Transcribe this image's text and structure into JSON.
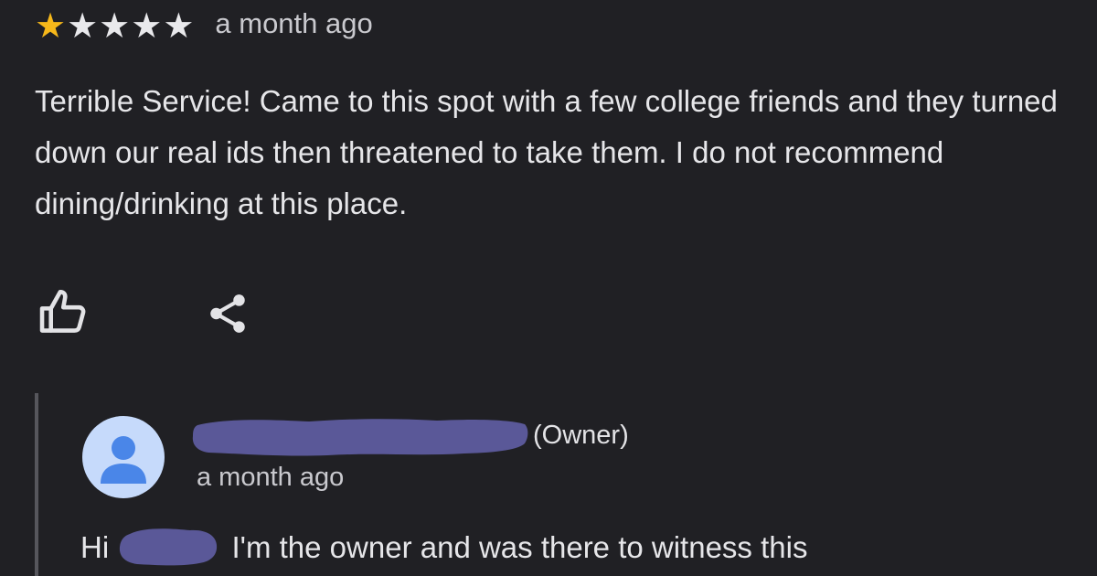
{
  "review": {
    "rating": 1,
    "max_rating": 5,
    "star_colors": {
      "filled": "#f6b81a",
      "empty": "#e9e9ec"
    },
    "date": "a month ago",
    "text": "Terrible Service! Came to this spot with a few college friends and they turned down our real ids then threatened to take them. I do not recommend dining/drinking at this place.",
    "actions": {
      "like_icon": "thumbs-up-outline-icon",
      "share_icon": "share-icon"
    }
  },
  "owner_reply": {
    "avatar_icon": "default-person-avatar",
    "avatar_colors": {
      "background": "#c6dafb",
      "figure": "#4a86e8"
    },
    "redaction_color": "#5a5898",
    "owner_tag": "(Owner)",
    "date": "a month ago",
    "greeting": "Hi",
    "text": "I'm the owner and was there to witness this"
  }
}
